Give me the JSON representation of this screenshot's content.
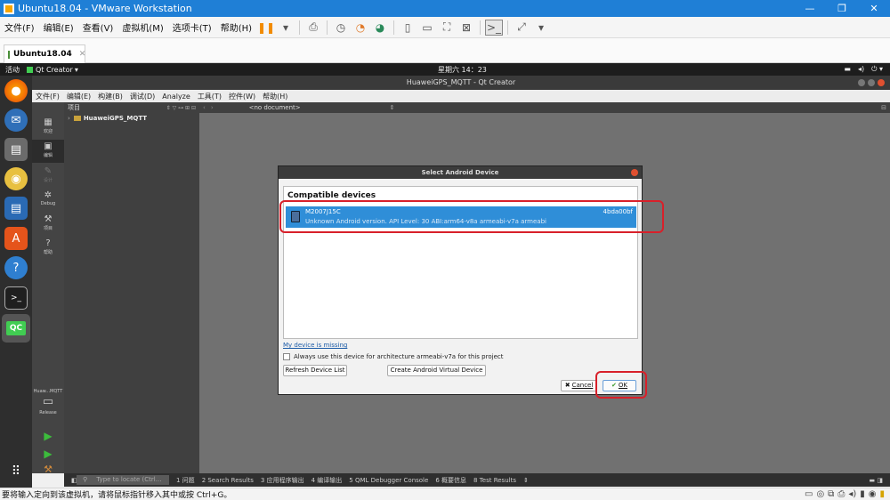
{
  "vmware": {
    "title": "Ubuntu18.04 - VMware Workstation",
    "window_controls": [
      "—",
      "❐",
      "✕"
    ],
    "menu": [
      "文件(F)",
      "编辑(E)",
      "查看(V)",
      "虚拟机(M)",
      "选项卡(T)",
      "帮助(H)"
    ],
    "tab_label": "Ubuntu18.04",
    "tab_close": "✕",
    "status_hint": "要将输入定向到该虚拟机，请将鼠标指针移入其中或按 Ctrl+G。"
  },
  "ubuntu": {
    "activities": "活动",
    "app_name": "Qt Creator",
    "clock": "星期六 14：23"
  },
  "qt": {
    "window_title": "HuaweiGPS_MQTT - Qt Creator",
    "menu": [
      "文件(F)",
      "编辑(E)",
      "构建(B)",
      "调试(D)",
      "Analyze",
      "工具(T)",
      "控件(W)",
      "帮助(H)"
    ],
    "modes": [
      {
        "icon": "welcome-icon",
        "label": "欢迎"
      },
      {
        "icon": "edit-icon",
        "label": "编辑"
      },
      {
        "icon": "design-icon",
        "label": "设计"
      },
      {
        "icon": "debug-icon",
        "label": "Debug"
      },
      {
        "icon": "project-icon",
        "label": "项目"
      },
      {
        "icon": "help-icon",
        "label": "帮助"
      }
    ],
    "projects_label": "项目",
    "project_name": "HuaweiGPS_MQTT",
    "no_document": "<no document>",
    "kit_label": "Huaw...MQTT",
    "build_config": "Release",
    "locator_placeholder": "Type to locate (Ctrl...",
    "output_panes": [
      "1 问题",
      "2 Search Results",
      "3 应用程序输出",
      "4 编译输出",
      "5 QML Debugger Console",
      "6 概要信息",
      "8 Test Results"
    ]
  },
  "dialog": {
    "title": "Select Android Device",
    "section_title": "Compatible devices",
    "device": {
      "name": "M2007J15C",
      "serial": "4bda00bf",
      "details": "Unknown Android version. API Level: 30  ABI:arm64-v8a armeabi-v7a armeabi"
    },
    "missing_link": "My device is missing",
    "always_use": "Always use this device for architecture armeabi-v7a for this project",
    "refresh_button": "Refresh Device List",
    "create_avd_button": "Create Android Virtual Device",
    "cancel_button": "Cancel",
    "ok_button": "OK"
  },
  "colors": {
    "vmware_blue": "#1f7fd6",
    "selection_blue": "#2f8ed8",
    "highlight_red": "#d8202a"
  }
}
